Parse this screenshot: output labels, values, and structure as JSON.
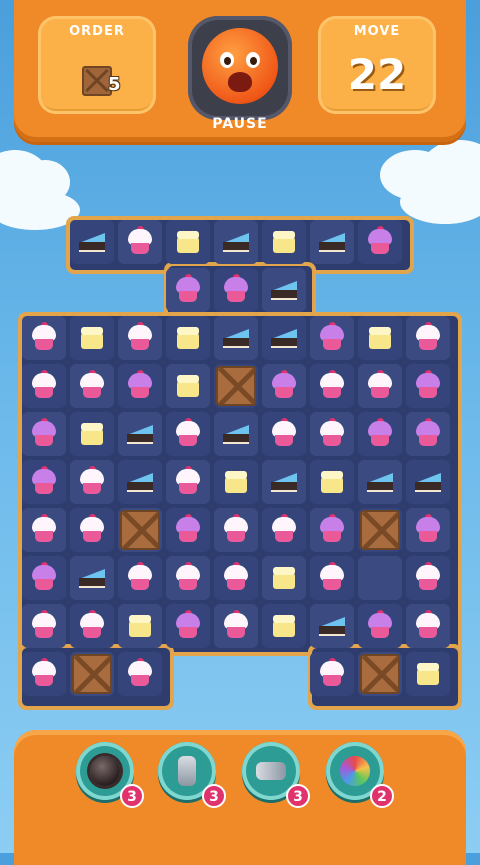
{
  "hud": {
    "order_label": "ORDER",
    "order_item_icon": "wooden-crate-icon",
    "order_count": "5",
    "move_label": "MOVE",
    "move_value": "22",
    "pause_label": "PAUSE",
    "pause_icon": "orange-monster-icon"
  },
  "board": {
    "rows": [
      [
        "void",
        "blue-slice",
        "pink-cupcake",
        "yellow-cake",
        "blue-slice",
        "yellow-cake",
        "blue-slice",
        "purple-cupcake",
        "void",
        "void"
      ],
      [
        "void",
        "void",
        "void",
        "purple-cupcake",
        "purple-cupcake",
        "blue-slice",
        "void",
        "void",
        "void",
        "void"
      ],
      [
        "pink-cupcake",
        "yellow-cake",
        "pink-cupcake",
        "yellow-cake",
        "blue-slice",
        "blue-slice",
        "purple-cupcake",
        "yellow-cake",
        "pink-cupcake",
        "void"
      ],
      [
        "pink-cupcake",
        "pink-cupcake",
        "purple-cupcake",
        "yellow-cake",
        "crate",
        "purple-cupcake",
        "pink-cupcake",
        "pink-cupcake",
        "purple-cupcake",
        "void"
      ],
      [
        "purple-cupcake",
        "yellow-cake",
        "blue-slice",
        "pink-cupcake",
        "blue-slice",
        "pink-cupcake",
        "pink-cupcake",
        "purple-cupcake",
        "purple-cupcake",
        "void"
      ],
      [
        "purple-cupcake",
        "pink-cupcake",
        "blue-slice",
        "pink-cupcake",
        "yellow-cake",
        "blue-slice",
        "yellow-cake",
        "blue-slice",
        "blue-slice",
        "void"
      ],
      [
        "pink-cupcake",
        "pink-cupcake",
        "crate",
        "purple-cupcake",
        "pink-cupcake",
        "pink-cupcake",
        "purple-cupcake",
        "crate",
        "purple-cupcake",
        "void"
      ],
      [
        "purple-cupcake",
        "blue-slice",
        "pink-cupcake",
        "pink-cupcake",
        "pink-cupcake",
        "yellow-cake",
        "pink-cupcake",
        "empty",
        "pink-cupcake",
        "void"
      ],
      [
        "pink-cupcake",
        "pink-cupcake",
        "yellow-cake",
        "purple-cupcake",
        "pink-cupcake",
        "yellow-cake",
        "blue-slice",
        "purple-cupcake",
        "pink-cupcake",
        "void"
      ],
      [
        "pink-cupcake",
        "crate",
        "pink-cupcake",
        "void",
        "void",
        "void",
        "pink-cupcake",
        "crate",
        "yellow-cake",
        "void"
      ]
    ]
  },
  "boosters": [
    {
      "name": "bomb-booster",
      "icon": "spiked-bomb-icon",
      "count": "3"
    },
    {
      "name": "vertical-rocket-booster",
      "icon": "vertical-arrows-icon",
      "count": "3"
    },
    {
      "name": "horizontal-rocket-booster",
      "icon": "horizontal-arrows-icon",
      "count": "3"
    },
    {
      "name": "color-ball-booster",
      "icon": "rainbow-ball-icon",
      "count": "2"
    }
  ],
  "colors": {
    "hud_orange": "#f08a28",
    "board_frame": "#e2a54c",
    "board_bg": "#2e3d6e",
    "booster_teal": "#2c9c95",
    "badge_pink": "#e0336e"
  }
}
